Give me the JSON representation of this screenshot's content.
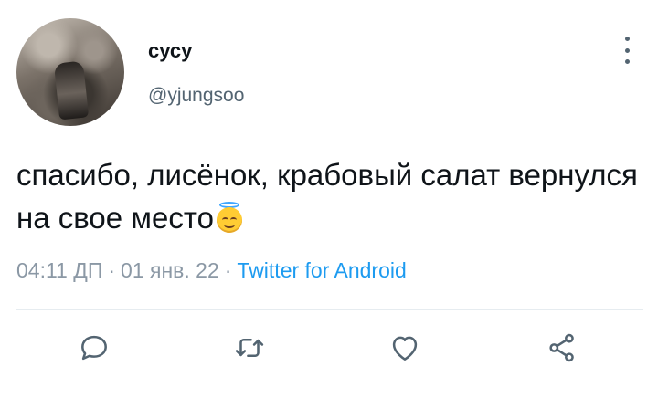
{
  "author": {
    "display_name": "сусу",
    "handle": "@yjungsoo",
    "avatar_icon": "user-photo"
  },
  "tweet": {
    "text": "спасибо, лисёнок, крабовый салат вернулся на свое место",
    "emoji": "smiling-face-with-halo"
  },
  "meta": {
    "time": "04:11 ДП",
    "separator": "·",
    "date": "01 янв. 22",
    "source": "Twitter for Android"
  },
  "actions": [
    {
      "name": "reply",
      "icon": "speech-bubble-icon"
    },
    {
      "name": "retweet",
      "icon": "retweet-icon"
    },
    {
      "name": "like",
      "icon": "heart-icon"
    },
    {
      "name": "share",
      "icon": "share-icon"
    }
  ],
  "colors": {
    "text": "#0f1419",
    "secondary": "#536471",
    "meta": "#8b98a5",
    "link": "#1d9bf0",
    "divider": "#e6ecf0"
  }
}
